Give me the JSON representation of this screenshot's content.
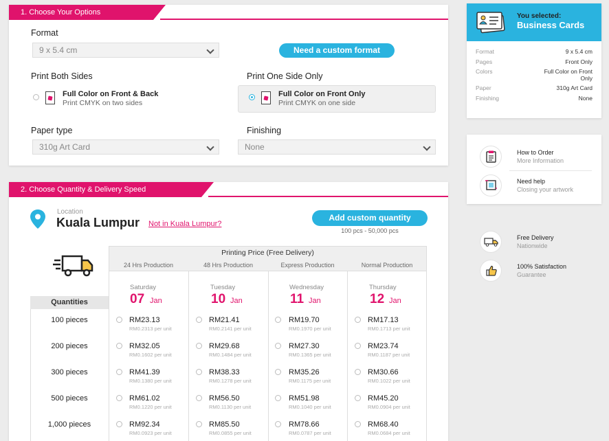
{
  "section1": {
    "title": "1. Choose Your Options",
    "format_label": "Format",
    "format_value": "9 x 5.4 cm",
    "custom_format_button": "Need a custom format",
    "both_sides_label": "Print Both Sides",
    "one_side_label": "Print One Side Only",
    "options": [
      {
        "title": "Full Color on Front & Back",
        "subtitle": "Print CMYK on two sides",
        "selected": false
      },
      {
        "title": "Full Color on Front Only",
        "subtitle": "Print CMYK on one side",
        "selected": true
      }
    ],
    "paper_label": "Paper type",
    "paper_value": "310g Art Card",
    "finishing_label": "Finishing",
    "finishing_value": "None"
  },
  "section2": {
    "title": "2. Choose Quantity & Delivery Speed",
    "location_label": "Location",
    "location_value": "Kuala Lumpur",
    "not_in_link": "Not in Kuala Lumpur?",
    "custom_qty_button": "Add custom quantity",
    "qty_range": "100 pcs - 50,000 pcs",
    "table_title": "Printing Price (Free Delivery)",
    "quantities_header": "Quantities",
    "columns": [
      {
        "production": "24 Hrs Production",
        "weekday": "Saturday",
        "day": "07",
        "month": "Jan"
      },
      {
        "production": "48 Hrs Production",
        "weekday": "Tuesday",
        "day": "10",
        "month": "Jan"
      },
      {
        "production": "Express Production",
        "weekday": "Wednesday",
        "day": "11",
        "month": "Jan"
      },
      {
        "production": "Normal Production",
        "weekday": "Thursday",
        "day": "12",
        "month": "Jan"
      }
    ],
    "rows": [
      {
        "qty": "100 pieces",
        "prices": [
          {
            "price": "RM23.13",
            "unit": "RM0.2313 per unit"
          },
          {
            "price": "RM21.41",
            "unit": "RM0.2141 per unit"
          },
          {
            "price": "RM19.70",
            "unit": "RM0.1970 per unit"
          },
          {
            "price": "RM17.13",
            "unit": "RM0.1713 per unit"
          }
        ]
      },
      {
        "qty": "200 pieces",
        "prices": [
          {
            "price": "RM32.05",
            "unit": "RM0.1602 per unit"
          },
          {
            "price": "RM29.68",
            "unit": "RM0.1484 per unit"
          },
          {
            "price": "RM27.30",
            "unit": "RM0.1365 per unit"
          },
          {
            "price": "RM23.74",
            "unit": "RM0.1187 per unit"
          }
        ]
      },
      {
        "qty": "300 pieces",
        "prices": [
          {
            "price": "RM41.39",
            "unit": "RM0.1380 per unit"
          },
          {
            "price": "RM38.33",
            "unit": "RM0.1278 per unit"
          },
          {
            "price": "RM35.26",
            "unit": "RM0.1175 per unit"
          },
          {
            "price": "RM30.66",
            "unit": "RM0.1022 per unit"
          }
        ]
      },
      {
        "qty": "500 pieces",
        "prices": [
          {
            "price": "RM61.02",
            "unit": "RM0.1220 per unit"
          },
          {
            "price": "RM56.50",
            "unit": "RM0.1130 per unit"
          },
          {
            "price": "RM51.98",
            "unit": "RM0.1040 per unit"
          },
          {
            "price": "RM45.20",
            "unit": "RM0.0904 per unit"
          }
        ]
      },
      {
        "qty": "1,000 pieces",
        "prices": [
          {
            "price": "RM92.34",
            "unit": "RM0.0923 per unit"
          },
          {
            "price": "RM85.50",
            "unit": "RM0.0855 per unit"
          },
          {
            "price": "RM78.66",
            "unit": "RM0.0787 per unit"
          },
          {
            "price": "RM68.40",
            "unit": "RM0.0684 per unit"
          }
        ]
      }
    ]
  },
  "summary": {
    "selected_label": "You selected:",
    "product": "Business Cards",
    "rows": [
      {
        "key": "Format",
        "value": "9 x 5.4 cm"
      },
      {
        "key": "Pages",
        "value": "Front Only"
      },
      {
        "key": "Colors",
        "value": "Full Color on Front Only"
      },
      {
        "key": "Paper",
        "value": "310g Art Card"
      },
      {
        "key": "Finishing",
        "value": "None"
      }
    ]
  },
  "help": {
    "items": [
      {
        "title": "How to Order",
        "subtitle": "More Information",
        "icon": "clipboard-icon"
      },
      {
        "title": "Need help",
        "subtitle": "Closing your artwork",
        "icon": "artwork-icon"
      }
    ]
  },
  "perks": {
    "items": [
      {
        "title": "Free Delivery",
        "subtitle": "Nationwide",
        "icon": "delivery-truck-icon"
      },
      {
        "title": "100% Satisfaction",
        "subtitle": "Guarantee",
        "icon": "thumbs-up-icon"
      }
    ]
  },
  "colors": {
    "accent": "#e0136c",
    "button": "#2ab3df"
  }
}
